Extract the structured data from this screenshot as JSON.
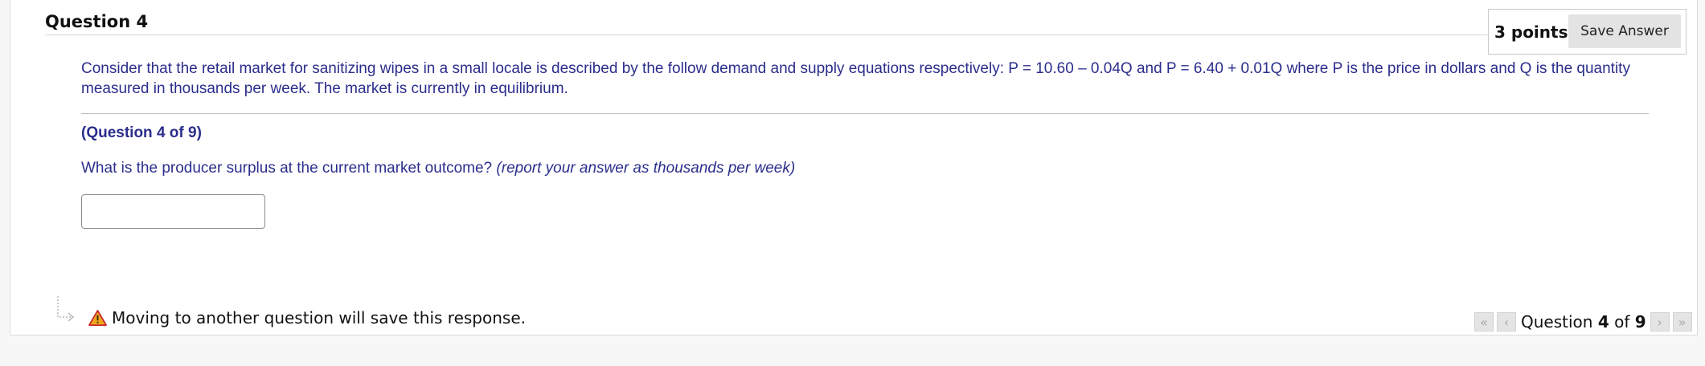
{
  "question": {
    "title": "Question 4",
    "points": "3 points",
    "save_label": "Save Answer",
    "prompt": "Consider that the retail market for sanitizing wipes in a small locale is described by the follow demand and supply equations respectively:  P = 10.60 – 0.04Q and P = 6.40 + 0.01Q where P is the price in dollars and Q is the quantity measured in thousands per week. The market is currently in equilibrium.",
    "sub_number": "(Question 4 of 9)",
    "text": "What is the producer surplus at the current market outcome?",
    "hint": "(report your answer as thousands per week)",
    "answer_value": "",
    "answer_placeholder": ""
  },
  "footer": {
    "message": "Moving to another question will save this response."
  },
  "pager": {
    "prefix": "Question",
    "current": "4",
    "of_word": "of",
    "total": "9",
    "first_glyph": "«",
    "prev_glyph": "‹",
    "next_glyph": "›",
    "last_glyph": "»"
  },
  "icons": {
    "warning": "warning-icon",
    "arrow": "branch-arrow-icon"
  },
  "colors": {
    "question_text": "#2b2e8c",
    "warning_fill": "#f0a520",
    "warning_stroke": "#c62828"
  }
}
